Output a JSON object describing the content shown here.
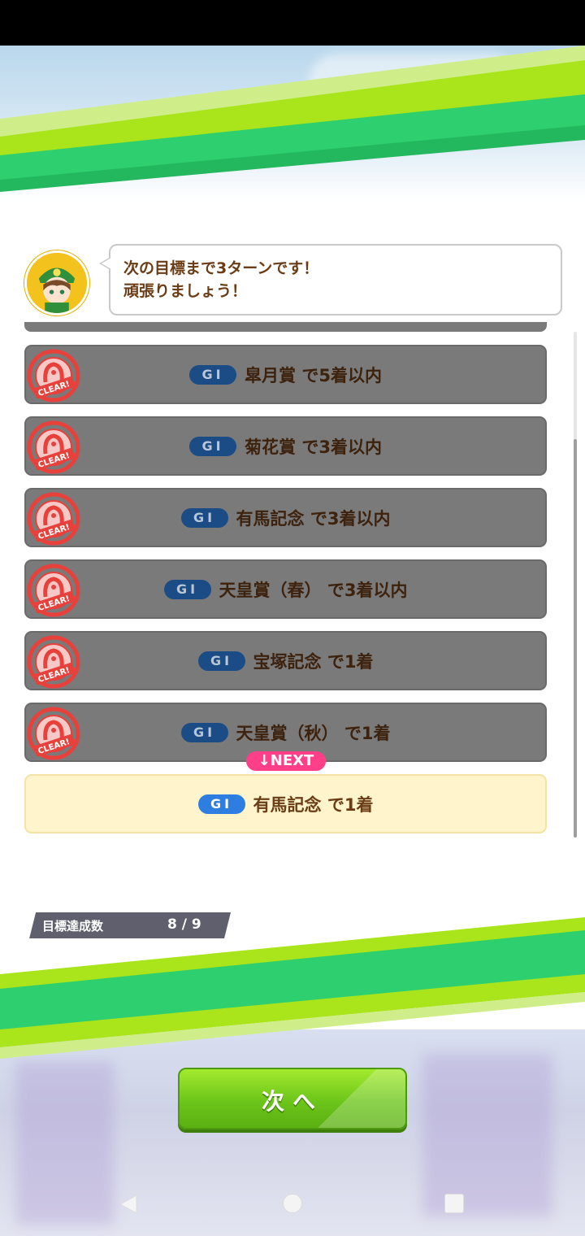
{
  "speech": {
    "lines": [
      "次の目標まで3ターンです！",
      "頑張りましょう！"
    ]
  },
  "goals": [
    {
      "grade": "GI",
      "text": "皐月賞 で5着以内",
      "stamp": "CLEAR!"
    },
    {
      "grade": "GI",
      "text": "菊花賞 で3着以内",
      "stamp": "CLEAR!"
    },
    {
      "grade": "GI",
      "text": "有馬記念 で3着以内",
      "stamp": "CLEAR!"
    },
    {
      "grade": "GI",
      "text": "天皇賞（春） で3着以内",
      "stamp": "CLEAR!"
    },
    {
      "grade": "GI",
      "text": "宝塚記念 で1着",
      "stamp": "CLEAR!"
    },
    {
      "grade": "GI",
      "text": "天皇賞（秋） で1着",
      "stamp": "CLEAR!"
    },
    {
      "grade": "GI",
      "text": "有馬記念 で1着"
    }
  ],
  "next_badge": "↓NEXT",
  "progress": {
    "label": "目標達成数",
    "value": "8 / 9"
  },
  "next_button": {
    "label": "次へ"
  },
  "colors": {
    "green_primary": "#2ecf6e",
    "green_lime": "#a9e51a",
    "text_brown": "#6b3d16",
    "cleared_row": "#7a7a7a",
    "next_row": "#fff4cc",
    "badge_pink": "#ff3f8a",
    "grade_blue": "#2d7ee0",
    "stamp_red": "#e8413c"
  },
  "icons": {
    "avatar": "character-avatar-icon",
    "stamp": "clear-stamp-icon",
    "nav": [
      "nav-back-icon",
      "nav-home-icon",
      "nav-recent-icon"
    ]
  }
}
